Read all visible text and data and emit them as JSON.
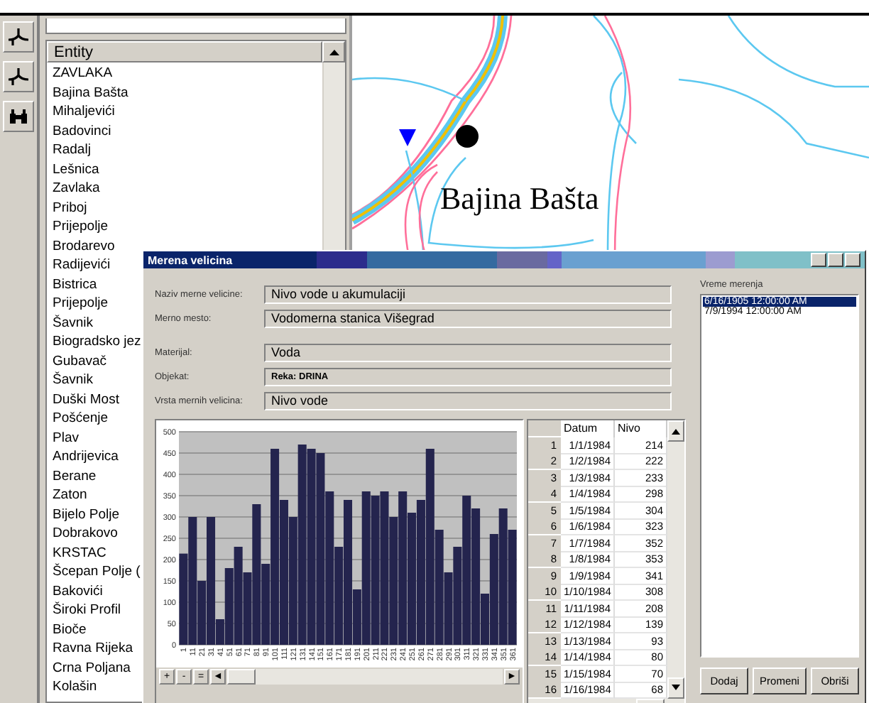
{
  "entity_panel": {
    "header": "Entity",
    "items": [
      "ZAVLAKA",
      "Bajina Bašta",
      "Mihaljevići",
      "Badovinci",
      "Radalj",
      "Lešnica",
      "Zavlaka",
      "Priboj",
      "Prijepolje",
      "Brodarevo",
      "Radijevići",
      "Bistrica",
      "Prijepolje",
      "Šavnik",
      "Biogradsko jez",
      "Gubavač",
      "Šavnik",
      "Duški Most",
      "Pošćenje",
      "Plav",
      "Andrijevica",
      "Berane",
      "Zaton",
      "Bijelo Polje",
      "Dobrakovo",
      "KRSTAC",
      "Šcepan Polje (",
      "Bakovići",
      "Široki Profil",
      "Bioče",
      "Ravna Rijeka",
      "Crna Poljana",
      "Kolašin"
    ]
  },
  "map": {
    "label": "Bajina Bašta"
  },
  "dialog": {
    "title": "Merena velicina",
    "field_groups": [
      [
        {
          "label": "Naziv merne velicine:",
          "value": "Nivo vode u akumulaciji",
          "bold": false
        },
        {
          "label": "Merno mesto:",
          "value": "Vodomerna stanica Višegrad",
          "bold": false
        }
      ],
      [
        {
          "label": "Materijal:",
          "value": "Voda",
          "bold": false
        },
        {
          "label": "Objekat:",
          "value": "Reka: DRINA",
          "bold": true
        },
        {
          "label": "Vrsta mernih velicina:",
          "value": "Nivo vode",
          "bold": false
        }
      ]
    ],
    "chart_data": {
      "type": "bar",
      "categories": [
        "1",
        "11",
        "21",
        "31",
        "41",
        "51",
        "61",
        "71",
        "81",
        "91",
        "101",
        "111",
        "121",
        "131",
        "141",
        "151",
        "161",
        "171",
        "181",
        "191",
        "201",
        "211",
        "221",
        "231",
        "241",
        "251",
        "261",
        "271",
        "281",
        "291",
        "301",
        "311",
        "321",
        "331",
        "341",
        "351",
        "361"
      ],
      "grid": true,
      "series": [
        {
          "color": "#24244e",
          "values": [
            214,
            300,
            150,
            300,
            60,
            180,
            230,
            170,
            330,
            190,
            460,
            340,
            300,
            470,
            460,
            450,
            360,
            230,
            340,
            130,
            360,
            350,
            360,
            300,
            360,
            310,
            340,
            460,
            270,
            170,
            230,
            350,
            320,
            120,
            260,
            320,
            270
          ]
        }
      ],
      "ylim": [
        0,
        500
      ],
      "yticks": [
        0,
        50,
        100,
        150,
        200,
        250,
        300,
        350,
        400,
        450,
        500
      ]
    },
    "chart_nav": [
      "+",
      "-",
      "=",
      "◄",
      "►"
    ],
    "table": {
      "columns": [
        "Datum",
        "Nivo"
      ],
      "rows": [
        {
          "n": "1",
          "datum": "1/1/1984",
          "nivo": "214"
        },
        {
          "n": "2",
          "datum": "1/2/1984",
          "nivo": "222"
        },
        {
          "n": "3",
          "datum": "1/3/1984",
          "nivo": "233"
        },
        {
          "n": "4",
          "datum": "1/4/1984",
          "nivo": "298"
        },
        {
          "n": "5",
          "datum": "1/5/1984",
          "nivo": "304"
        },
        {
          "n": "6",
          "datum": "1/6/1984",
          "nivo": "323"
        },
        {
          "n": "7",
          "datum": "1/7/1984",
          "nivo": "352"
        },
        {
          "n": "8",
          "datum": "1/8/1984",
          "nivo": "353"
        },
        {
          "n": "9",
          "datum": "1/9/1984",
          "nivo": "341"
        },
        {
          "n": "10",
          "datum": "1/10/1984",
          "nivo": "308"
        },
        {
          "n": "11",
          "datum": "1/11/1984",
          "nivo": "208"
        },
        {
          "n": "12",
          "datum": "1/12/1984",
          "nivo": "139"
        },
        {
          "n": "13",
          "datum": "1/13/1984",
          "nivo": "93"
        },
        {
          "n": "14",
          "datum": "1/14/1984",
          "nivo": "80"
        },
        {
          "n": "15",
          "datum": "1/15/1984",
          "nivo": "70"
        },
        {
          "n": "16",
          "datum": "1/16/1984",
          "nivo": "68"
        }
      ]
    },
    "times": {
      "label": "Vreme merenja",
      "items": [
        {
          "text": "6/16/1905 12:00:00 AM",
          "selected": true
        },
        {
          "text": "7/9/1994 12:00:00 AM",
          "selected": false
        }
      ]
    },
    "buttons": [
      "Dodaj",
      "Promeni",
      "Obriši"
    ]
  }
}
